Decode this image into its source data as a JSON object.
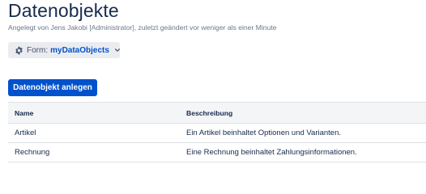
{
  "page": {
    "title": "Datenobjekte",
    "byline": "Angelegt von Jens Jakobi [Administrator], zuletzt geändert vor weniger als einer Minute"
  },
  "form_selector": {
    "label": "Form:",
    "value": "myDataObjects",
    "icon": "gear-icon"
  },
  "actions": {
    "create_label": "Datenobjekt anlegen"
  },
  "table": {
    "columns": [
      "Name",
      "Beschreibung"
    ],
    "rows": [
      {
        "name": "Artikel",
        "description": "Ein Artikel beinhaltet Optionen und Varianten."
      },
      {
        "name": "Rechnung",
        "description": "Eine Rechnung beinhaltet Zahlungsinformationen."
      }
    ]
  },
  "colors": {
    "primary": "#0052cc",
    "text": "#172b4d",
    "muted": "#6b778c",
    "header_bg": "#f4f5f7",
    "button_bg": "#ebecf0"
  }
}
